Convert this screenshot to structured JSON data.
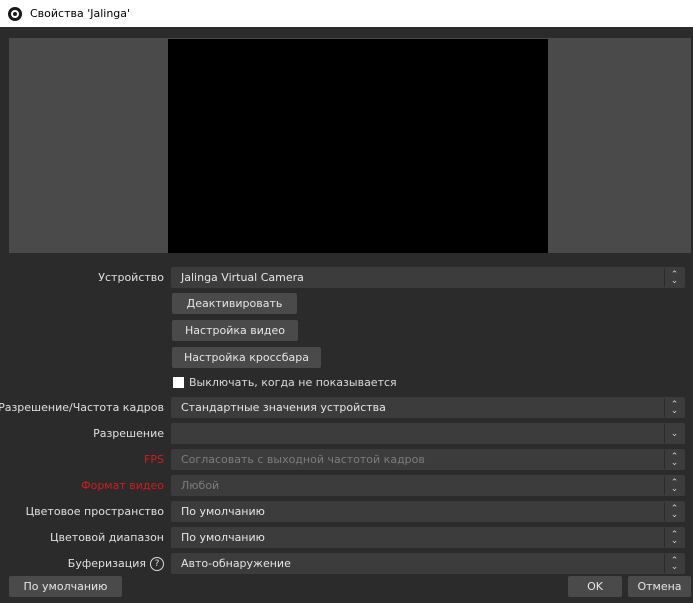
{
  "window": {
    "title": "Свойства 'Jalinga'"
  },
  "form": {
    "device_label": "Устройство",
    "device_value": "Jalinga Virtual Camera",
    "btn_deactivate": "Деактивировать",
    "btn_video_config": "Настройка видео",
    "btn_crossbar": "Настройка кроссбара",
    "checkbox_label": "Выключать, когда не показывается",
    "res_fps_label": "Разрешение/Частота кадров",
    "res_fps_value": "Стандартные значения устройства",
    "resolution_label": "Разрешение",
    "resolution_value": "",
    "fps_label": "FPS",
    "fps_value": "Согласовать с выходной частотой кадров",
    "format_label": "Формат видео",
    "format_value": "Любой",
    "colorspace_label": "Цветовое пространство",
    "colorspace_value": "По умолчанию",
    "colorrange_label": "Цветовой диапазон",
    "colorrange_value": "По умолчанию",
    "buffering_label": "Буферизация",
    "buffering_help": "?",
    "buffering_value": "Авто-обнаружение"
  },
  "footer": {
    "defaults_button": "По умолчанию",
    "ok_button": "OK",
    "cancel_button": "Отмена"
  },
  "icons": {
    "logo": "obs-logo-icon",
    "spin": "up-down-icon",
    "dropdown": "chevron-down-icon",
    "help": "help-icon"
  }
}
